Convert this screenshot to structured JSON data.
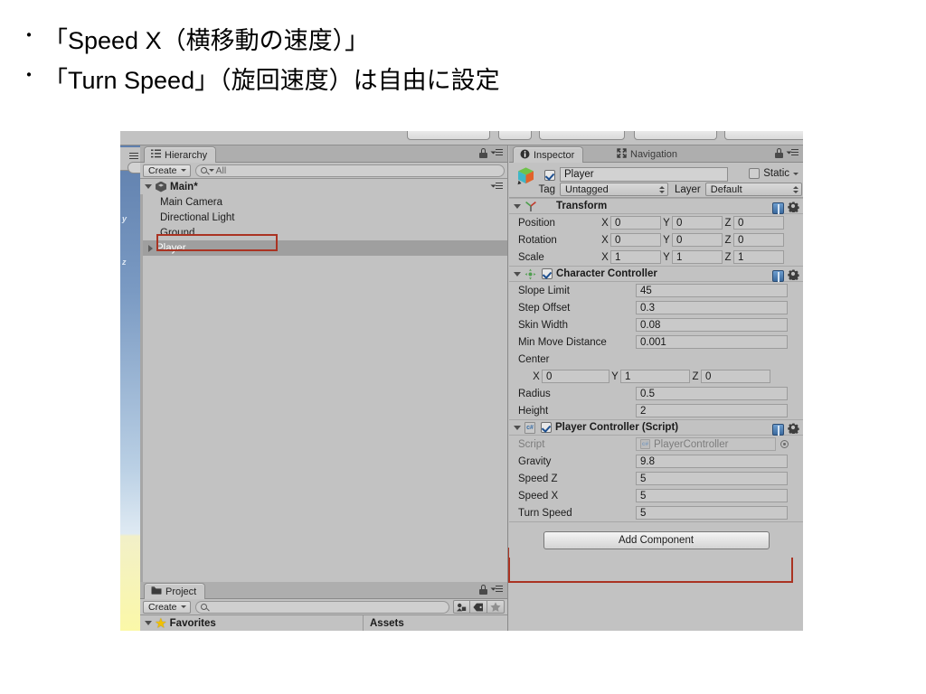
{
  "slide": {
    "bullets": [
      {
        "marker": "・",
        "text": "「Speed X（横移動の速度）」"
      },
      {
        "marker": "・",
        "text": "「Turn Speed」（旋回速度）は自由に設定"
      }
    ]
  },
  "colors": {
    "highlight_red": "#aa3322",
    "panel_bg": "#c2c2c2",
    "tabbar_bg": "#aeaeae",
    "selection_gray": "#9f9f9f",
    "field_bg": "#c9c9c9",
    "sky_blue": "#7a9ac3",
    "ground_yellow": "#fbf8a8",
    "checkbox_check": "#1d4f8f",
    "star_yellow": "#f0c000"
  },
  "hierarchy": {
    "tab_label": "Hierarchy",
    "tab_icon": "hierarchy-list-icon",
    "lock_icon": "lock-icon",
    "menu_icon": "panel-menu-icon",
    "create_label": "Create",
    "search_placeholder": "All",
    "search_value": "All",
    "search_icon": "search-icon",
    "root": {
      "label": "Main*",
      "icon": "unity-scene-icon",
      "expanded": true
    },
    "items": [
      {
        "label": "Main Camera",
        "selected": false,
        "has_children": false
      },
      {
        "label": "Directional Light",
        "selected": false,
        "has_children": false
      },
      {
        "label": "Ground",
        "selected": false,
        "has_children": false
      },
      {
        "label": "Player",
        "selected": true,
        "has_children": true
      }
    ]
  },
  "project": {
    "tab_label": "Project",
    "tab_icon": "folder-icon",
    "create_label": "Create",
    "search_placeholder": "",
    "search_icon": "search-icon",
    "icon_buttons": [
      "asset-label-icon",
      "tag-icon",
      "favorite-star-icon"
    ],
    "columns": [
      {
        "label": "Favorites",
        "icon": "star-icon",
        "expanded": true
      },
      {
        "label": "Assets",
        "icon": ""
      }
    ]
  },
  "inspector": {
    "tabs": [
      {
        "label": "Inspector",
        "icon": "info-circle-icon",
        "active": true
      },
      {
        "label": "Navigation",
        "icon": "navigation-arrows-icon",
        "active": false
      }
    ],
    "lock_icon": "lock-icon",
    "menu_icon": "panel-menu-icon",
    "gameobject": {
      "icon": "cube-prefab-icon",
      "enabled": true,
      "name": "Player",
      "static_label": "Static",
      "static_checked": false,
      "tag_label": "Tag",
      "tag_value": "Untagged",
      "layer_label": "Layer",
      "layer_value": "Default"
    },
    "components": [
      {
        "name": "Transform",
        "icon": "transform-axes-icon",
        "expanded": true,
        "has_checkbox": false,
        "help_icon": "help-book-icon",
        "gear_icon": "gear-icon",
        "vector_rows": [
          {
            "label": "Position",
            "x": "0",
            "y": "0",
            "z": "0"
          },
          {
            "label": "Rotation",
            "x": "0",
            "y": "0",
            "z": "0"
          },
          {
            "label": "Scale",
            "x": "1",
            "y": "1",
            "z": "1"
          }
        ]
      },
      {
        "name": "Character Controller",
        "icon": "character-controller-icon",
        "expanded": true,
        "has_checkbox": true,
        "checkbox_checked": true,
        "help_icon": "help-book-icon",
        "gear_icon": "gear-icon",
        "rows": [
          {
            "label": "Slope Limit",
            "value": "45"
          },
          {
            "label": "Step Offset",
            "value": "0.3"
          },
          {
            "label": "Skin Width",
            "value": "0.08"
          },
          {
            "label": "Min Move Distance",
            "value": "0.001"
          }
        ],
        "center_label": "Center",
        "center": {
          "x": "0",
          "y": "1",
          "z": "0"
        },
        "rows2": [
          {
            "label": "Radius",
            "value": "0.5"
          },
          {
            "label": "Height",
            "value": "2"
          }
        ]
      },
      {
        "name": "Player Controller (Script)",
        "icon": "csharp-script-icon",
        "expanded": true,
        "has_checkbox": true,
        "checkbox_checked": true,
        "help_icon": "help-book-icon",
        "gear_icon": "gear-icon",
        "script_row": {
          "label": "Script",
          "value": "PlayerController",
          "icon": "csharp-script-icon",
          "selector_icon": "target-selector-icon"
        },
        "rows": [
          {
            "label": "Gravity",
            "value": "9.8",
            "highlighted": false
          },
          {
            "label": "Speed Z",
            "value": "5",
            "highlighted": false
          },
          {
            "label": "Speed X",
            "value": "5",
            "highlighted": true
          },
          {
            "label": "Turn Speed",
            "value": "5",
            "highlighted": true
          }
        ]
      }
    ],
    "add_component_label": "Add Component"
  },
  "axis_labels": {
    "x": "X",
    "y": "Y",
    "z": "Z"
  }
}
